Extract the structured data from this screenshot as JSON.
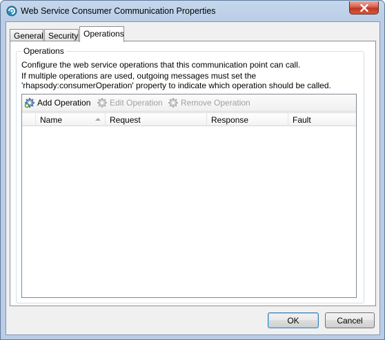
{
  "window": {
    "title": "Web Service Consumer Communication Properties",
    "accent_color": "#b9cde6",
    "close_color": "#c8442f"
  },
  "tabs": [
    {
      "label": "General",
      "selected": false
    },
    {
      "label": "Security",
      "selected": false
    },
    {
      "label": "Operations",
      "selected": true
    }
  ],
  "operations": {
    "group_label": "Operations",
    "description_line1": "Configure the web service operations that this communication point can call.",
    "description_line2": "If multiple operations are used, outgoing messages must set the 'rhapsody:consumerOperation' property to indicate which operation should be called.",
    "toolbar": {
      "add": {
        "label": "Add Operation",
        "icon": "gear-add-icon",
        "enabled": true
      },
      "edit": {
        "label": "Edit Operation",
        "icon": "gear-edit-icon",
        "enabled": false
      },
      "remove": {
        "label": "Remove Operation",
        "icon": "gear-remove-icon",
        "enabled": false
      }
    },
    "columns": [
      "Name",
      "Request",
      "Response",
      "Fault"
    ],
    "sort_column": "Name",
    "rows": []
  },
  "buttons": {
    "ok": "OK",
    "cancel": "Cancel"
  }
}
